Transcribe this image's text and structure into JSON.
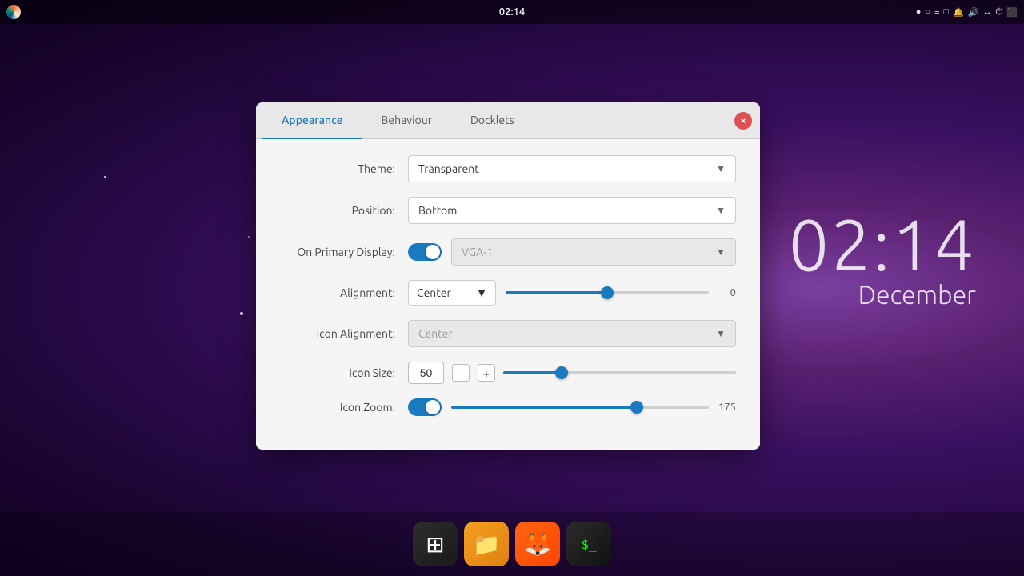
{
  "desktop": {
    "time": "02:14",
    "date": "December"
  },
  "topbar": {
    "clock": "02:14",
    "icons": [
      "●",
      "○",
      "≡",
      "□",
      "🔔",
      "🔊",
      "↔",
      "⏻",
      "⬛"
    ]
  },
  "dialog": {
    "tabs": [
      {
        "label": "Appearance",
        "active": true
      },
      {
        "label": "Behaviour",
        "active": false
      },
      {
        "label": "Docklets",
        "active": false
      }
    ],
    "close_label": "×",
    "theme_label": "Theme:",
    "theme_value": "Transparent",
    "position_label": "Position:",
    "position_value": "Bottom",
    "primary_display_label": "On Primary Display:",
    "primary_display_toggle": true,
    "primary_display_monitor": "VGA-1",
    "alignment_label": "Alignment:",
    "alignment_value": "Center",
    "alignment_slider_value": "0",
    "alignment_slider_percent": 50,
    "icon_alignment_label": "Icon Alignment:",
    "icon_alignment_value": "Center",
    "icon_size_label": "Icon Size:",
    "icon_size_value": "50",
    "icon_size_slider_percent": 25,
    "icon_zoom_label": "Icon Zoom:",
    "icon_zoom_toggle": true,
    "icon_zoom_value": "175",
    "icon_zoom_slider_percent": 72
  },
  "dock": {
    "icons": [
      {
        "name": "grid",
        "symbol": "⊞",
        "label": "App Grid"
      },
      {
        "name": "files",
        "symbol": "📁",
        "label": "Files"
      },
      {
        "name": "firefox",
        "symbol": "🦊",
        "label": "Firefox"
      },
      {
        "name": "terminal",
        "symbol": ">_",
        "label": "Terminal"
      }
    ]
  }
}
